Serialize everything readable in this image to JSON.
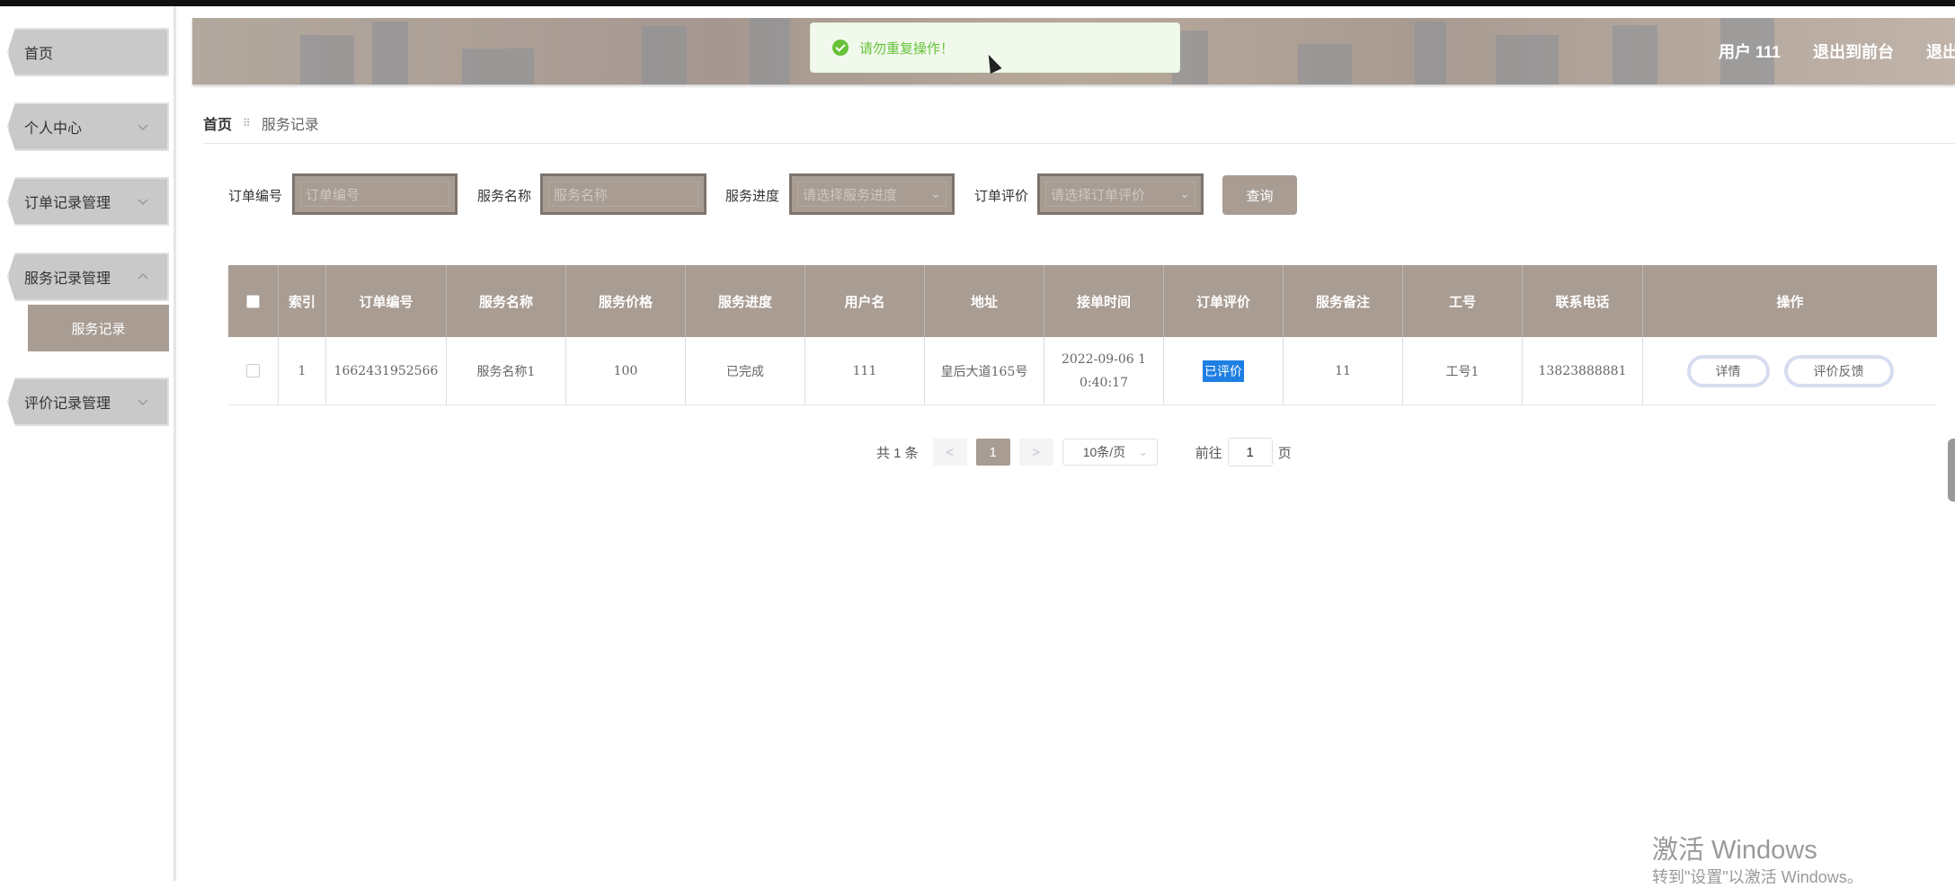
{
  "sidebar": {
    "items": [
      {
        "label": "首页"
      },
      {
        "label": "个人中心"
      },
      {
        "label": "订单记录管理"
      },
      {
        "label": "服务记录管理"
      },
      {
        "label": "评价记录管理"
      }
    ],
    "sub_item": "服务记录"
  },
  "header": {
    "user": "用户  111",
    "to_front": "退出到前台",
    "logout": "退出登录"
  },
  "toast": {
    "message": "请勿重复操作！"
  },
  "breadcrumb": {
    "home": "首页",
    "current": "服务记录"
  },
  "search": {
    "order_no_label": "订单编号",
    "order_no_placeholder": "订单编号",
    "service_name_label": "服务名称",
    "service_name_placeholder": "服务名称",
    "progress_label": "服务进度",
    "progress_placeholder": "请选择服务进度",
    "rating_label": "订单评价",
    "rating_placeholder": "请选择订单评价",
    "query_button": "查询"
  },
  "table": {
    "headers": [
      "索引",
      "订单编号",
      "服务名称",
      "服务价格",
      "服务进度",
      "用户名",
      "地址",
      "接单时间",
      "订单评价",
      "服务备注",
      "工号",
      "联系电话",
      "操作"
    ],
    "rows": [
      {
        "index": "1",
        "order_no": "1662431952566",
        "service_name": "服务名称1",
        "price": "100",
        "progress": "已完成",
        "username": "111",
        "address": "皇后大道165号",
        "time_line1": "2022-09-06 1",
        "time_line2": "0:40:17",
        "rating": "已评价",
        "remark": "11",
        "staff_no": "工号1",
        "phone": "13823888881",
        "detail_btn": "详情",
        "feedback_btn": "评价反馈"
      }
    ]
  },
  "pagination": {
    "total": "共 1 条",
    "prev": "<",
    "page": "1",
    "next": ">",
    "page_size": "10条/页",
    "goto_label": "前往",
    "goto_value": "1",
    "goto_suffix": "页"
  },
  "watermark": {
    "line1": "激活 Windows",
    "line2": "转到\"设置\"以激活 Windows。"
  },
  "colors": {
    "accent": "#a89c93",
    "toast_green": "#67c23a",
    "rated_blue": "#1e7fe3"
  }
}
